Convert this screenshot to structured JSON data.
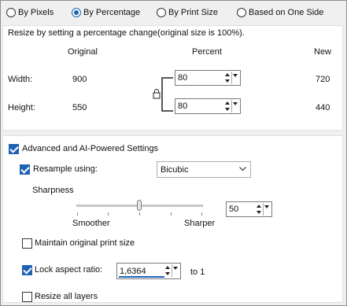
{
  "resize_modes": [
    {
      "label": "By Pixels",
      "selected": false
    },
    {
      "label": "By Percentage",
      "selected": true
    },
    {
      "label": "By Print Size",
      "selected": false
    },
    {
      "label": "Based on One Side",
      "selected": false
    }
  ],
  "description": "Resize by setting a percentage change(original size is 100%).",
  "columns": {
    "original": "Original",
    "percent": "Percent",
    "new": "New"
  },
  "width": {
    "label": "Width:",
    "original": "900",
    "percent": "80",
    "new": "720"
  },
  "height": {
    "label": "Height:",
    "original": "550",
    "percent": "80",
    "new": "440"
  },
  "advanced": {
    "label": "Advanced and AI-Powered Settings",
    "checked": true
  },
  "resample": {
    "label": "Resample using:",
    "checked": true,
    "method": "Bicubic"
  },
  "sharpness": {
    "label": "Sharpness",
    "smoother": "Smoother",
    "sharper": "Sharper",
    "value": "50",
    "level": 0.5
  },
  "maintain_print": {
    "label": "Maintain original print size",
    "checked": false
  },
  "lock_aspect": {
    "label": "Lock aspect ratio:",
    "checked": true,
    "value": "1,6364",
    "suffix": "to 1"
  },
  "resize_layers": {
    "label": "Resize all layers",
    "checked": false
  },
  "colors": {
    "accent": "#1f63b5"
  }
}
